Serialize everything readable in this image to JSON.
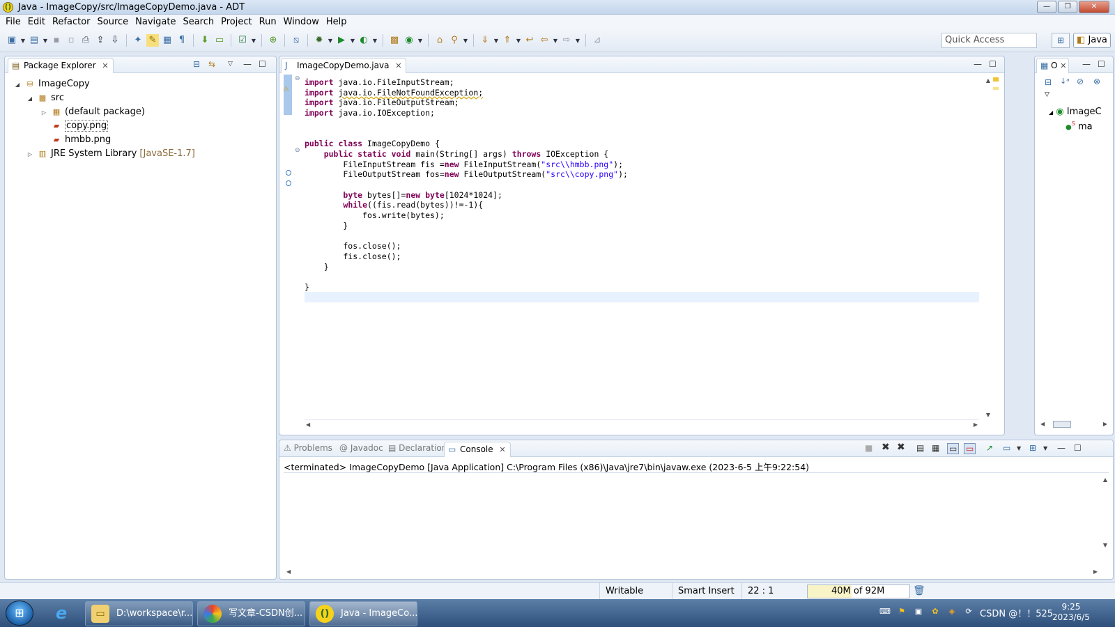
{
  "window": {
    "title": "Java - ImageCopy/src/ImageCopyDemo.java - ADT",
    "buttons": {
      "minimize": "—",
      "maximize": "❐",
      "close": "✕"
    }
  },
  "menu": [
    "File",
    "Edit",
    "Refactor",
    "Source",
    "Navigate",
    "Search",
    "Project",
    "Run",
    "Window",
    "Help"
  ],
  "toolbar": {
    "quick_access_placeholder": "Quick Access",
    "perspective": "Java"
  },
  "package_explorer": {
    "title": "Package Explorer",
    "tree": {
      "project": "ImageCopy",
      "src": "src",
      "default_package": "(default package)",
      "file1": "copy.png",
      "file2": "hmbb.png",
      "jre": "JRE System Library",
      "jre_version": "[JavaSE-1.7]"
    }
  },
  "editor": {
    "tab": "ImageCopyDemo.java",
    "lines": {
      "l1": "java.io.FileInputStream;",
      "l2": "java.io.FileNotFoundException;",
      "l3": "java.io.FileOutputStream;",
      "l4": "java.io.IOException;",
      "import": "import"
    }
  },
  "outline": {
    "title": "O",
    "class": "ImageC",
    "method": "ma"
  },
  "bottom": {
    "tabs": {
      "problems": "Problems",
      "javadoc": "Javadoc",
      "declaration": "Declaration",
      "console": "Console"
    },
    "console_status": "<terminated> ImageCopyDemo [Java Application] C:\\Program Files (x86)\\Java\\jre7\\bin\\javaw.exe (2023-6-5 上午9:22:54)"
  },
  "status": {
    "writable": "Writable",
    "insert_mode": "Smart Insert",
    "position": "22 : 1",
    "heap": "40M of 92M",
    "heap_used_fraction": 0.43
  },
  "taskbar": {
    "items": [
      {
        "label": "D:\\workspace\\r..."
      },
      {
        "label": "写文章-CSDN创..."
      },
      {
        "label": "Java - ImageCo..."
      }
    ],
    "clock_time": "9:25",
    "clock_date": "2023/6/5",
    "tray_text": "CSDN @！！525"
  }
}
